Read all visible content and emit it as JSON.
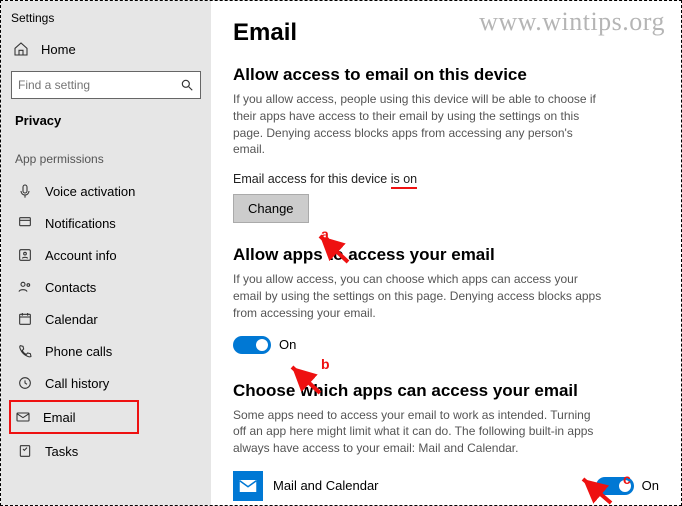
{
  "app_title": "Settings",
  "home_label": "Home",
  "search_placeholder": "Find a setting",
  "privacy_label": "Privacy",
  "section_label": "App permissions",
  "nav": [
    {
      "label": "Voice activation"
    },
    {
      "label": "Notifications"
    },
    {
      "label": "Account info"
    },
    {
      "label": "Contacts"
    },
    {
      "label": "Calendar"
    },
    {
      "label": "Phone calls"
    },
    {
      "label": "Call history"
    },
    {
      "label": "Email"
    },
    {
      "label": "Tasks"
    }
  ],
  "page": {
    "title": "Email",
    "block1": {
      "title": "Allow access to email on this device",
      "desc": "If you allow access, people using this device will be able to choose if their apps have access to their email by using the settings on this page. Denying access blocks apps from accessing any person's email.",
      "status_prefix": "Email access for this device ",
      "status_value": "is on",
      "button": "Change"
    },
    "block2": {
      "title": "Allow apps to access your email",
      "desc": "If you allow access, you can choose which apps can access your email by using the settings on this page. Denying access blocks apps from accessing your email.",
      "toggle": "On"
    },
    "block3": {
      "title": "Choose which apps can access your email",
      "desc": "Some apps need to access your email to work as intended. Turning off an app here might limit what it can do. The following built-in apps always have access to your email: Mail and Calendar.",
      "app_name": "Mail and Calendar",
      "toggle": "On"
    }
  },
  "annotations": {
    "a": "a",
    "b": "b",
    "c": "c"
  },
  "watermark": "www.wintips.org"
}
